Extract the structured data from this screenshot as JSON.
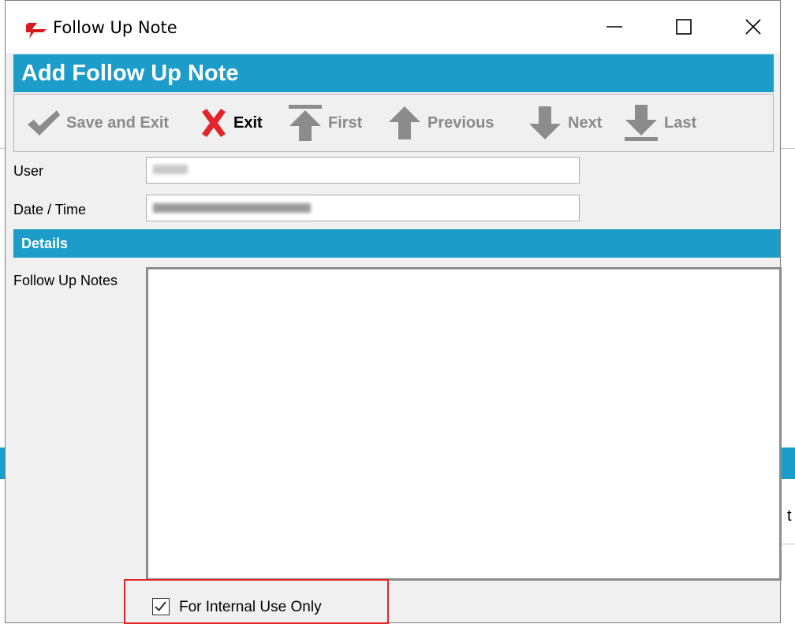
{
  "window": {
    "title": "Follow Up Note",
    "app_icon": "red-flag-icon",
    "controls": [
      "minimize-icon",
      "maximize-icon",
      "close-icon"
    ]
  },
  "header": {
    "title": "Add Follow Up Note"
  },
  "toolbar": {
    "buttons": [
      {
        "label": "Save and Exit",
        "icon": "checkmark-icon",
        "enabled": false
      },
      {
        "label": "Exit",
        "icon": "x-icon",
        "enabled": true
      },
      {
        "label": "First",
        "icon": "arrow-up-to-bar-icon",
        "enabled": false
      },
      {
        "label": "Previous",
        "icon": "arrow-up-icon",
        "enabled": false
      },
      {
        "label": "Next",
        "icon": "arrow-down-icon",
        "enabled": false
      },
      {
        "label": "Last",
        "icon": "arrow-down-to-bar-icon",
        "enabled": false
      }
    ]
  },
  "form": {
    "user_label": "User",
    "user_value": "",
    "datetime_label": "Date / Time",
    "datetime_value": ""
  },
  "details": {
    "title": "Details",
    "notes_label": "Follow Up Notes",
    "notes_value": ""
  },
  "internal": {
    "label": "For Internal Use Only",
    "checked": true
  },
  "colors": {
    "accent": "#1b9cc9",
    "highlight": "#e3242b",
    "exit_icon": "#e3242b",
    "disabled_icon": "#8c8c8c"
  }
}
